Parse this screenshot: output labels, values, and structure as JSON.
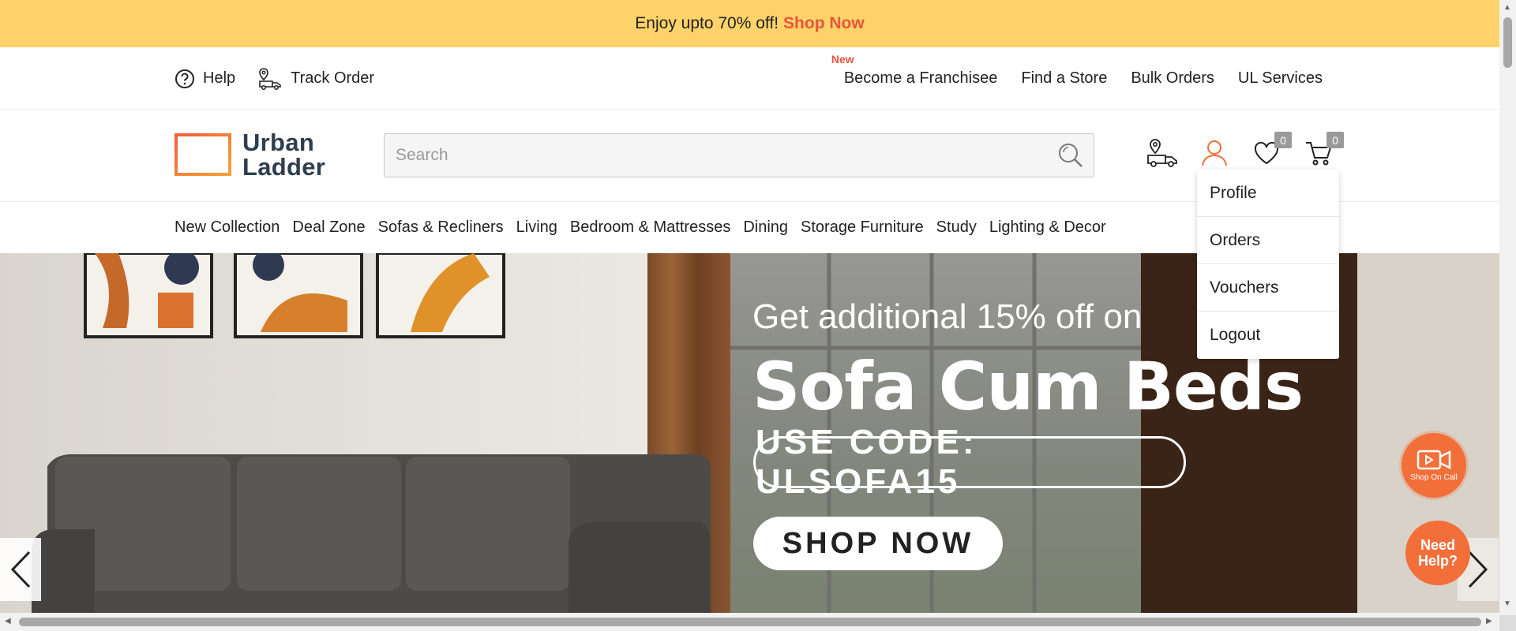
{
  "promo": {
    "text": "Enjoy upto 70% off!",
    "link": "Shop Now"
  },
  "utility": {
    "help": "Help",
    "track_order": "Track Order",
    "new_badge": "New",
    "links": [
      "Become a Franchisee",
      "Find a Store",
      "Bulk Orders",
      "UL Services"
    ]
  },
  "header": {
    "logo_line1": "Urban",
    "logo_line2": "Ladder",
    "search_placeholder": "Search",
    "wishlist_count": "0",
    "cart_count": "0"
  },
  "nav": {
    "items": [
      "New Collection",
      "Deal Zone",
      "Sofas & Recliners",
      "Living",
      "Bedroom & Mattresses",
      "Dining",
      "Storage Furniture",
      "Study",
      "Lighting & Decor"
    ]
  },
  "account_menu": {
    "items": [
      "Profile",
      "Orders",
      "Vouchers",
      "Logout"
    ]
  },
  "hero": {
    "line1": "Get additional 15% off on",
    "line2": "Sofa Cum Beds",
    "code": "USE CODE: ULSOFA15",
    "cta": "SHOP NOW"
  },
  "floating": {
    "call_label": "Shop On Call",
    "help_label": "Need Help?"
  },
  "colors": {
    "promo_bg": "#ffd36a",
    "accent": "#e8553c",
    "float_bg": "#f26f3a"
  }
}
